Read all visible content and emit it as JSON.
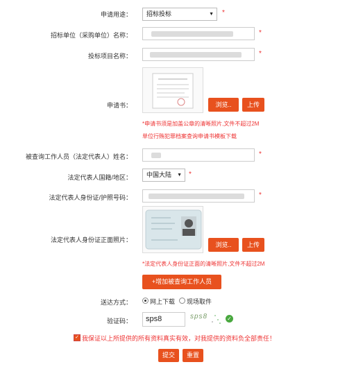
{
  "form": {
    "purpose": {
      "label": "申请用途：",
      "value": "招标投标"
    },
    "tender_unit": {
      "label": "招标单位（采购单位）名称："
    },
    "project": {
      "label": "投标项目名称："
    },
    "letter": {
      "label": "申请书：",
      "browse": "浏览..",
      "upload": "上传",
      "hint": "*申请书须是加盖公章的清晰照片,文件不超过2M",
      "link": "单位行贿犯罪档案查询申请书模板下载"
    },
    "person": {
      "label": "被查询工作人员（法定代表人）姓名："
    },
    "nationality": {
      "label": "法定代表人国籍/地区：",
      "value": "中国大陆"
    },
    "id_no": {
      "label": "法定代表人身份证/护照号码："
    },
    "id_photo": {
      "label": "法定代表人身份证正面照片：",
      "browse": "浏览..",
      "upload": "上传",
      "hint": "*法定代表人身份证正面的清晰照片,文件不超过2M"
    },
    "add_person": "+增加被查询工作人员",
    "delivery": {
      "label": "送达方式：",
      "opt1": "网上下载",
      "opt2": "现场取件"
    },
    "captcha": {
      "label": "验证码：",
      "value": "sps8",
      "image_text": "sps8"
    },
    "declaration": "我保证以上所提供的所有资料真实有效，对我提供的资料负全部责任！",
    "submit": "提交",
    "reset": "重置",
    "required_mark": "*"
  },
  "colors": {
    "accent": "#e8511e",
    "required": "#e33333"
  }
}
